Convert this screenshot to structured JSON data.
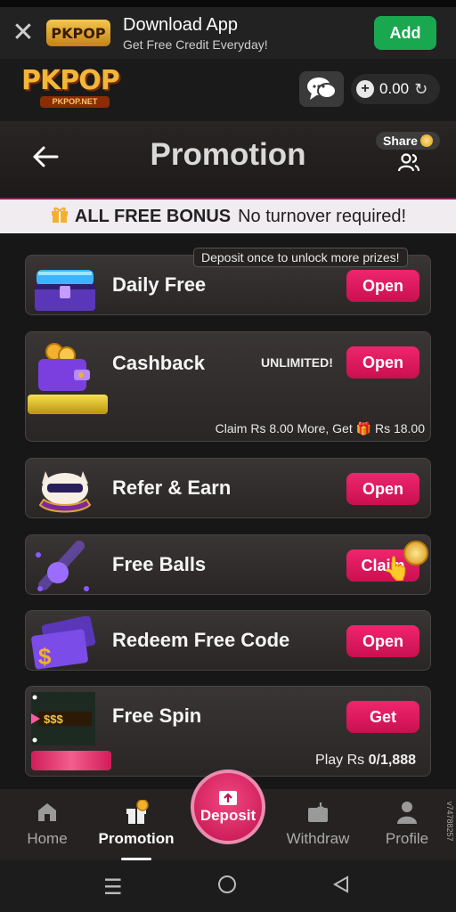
{
  "download_bar": {
    "close_icon": "close-icon",
    "logo_text": "PKPOP",
    "title": "Download App",
    "subtitle": "Get Free Credit Everyday!",
    "add_label": "Add"
  },
  "header": {
    "brand_main": "PKPOP",
    "brand_sub": "PKPOP.NET",
    "balance": "0.00"
  },
  "title_bar": {
    "title": "Promotion",
    "share_label": "Share"
  },
  "bonus_bar": {
    "title": "ALL FREE BONUS",
    "subtitle": "No turnover required!"
  },
  "cards": {
    "daily": {
      "label": "Daily Free",
      "button": "Open",
      "tip": "Deposit once to unlock more prizes!"
    },
    "cashback": {
      "label": "Cashback",
      "badge": "UNLIMITED!",
      "button": "Open",
      "claim_text": "Claim Rs 8.00 More, Get",
      "claim_amount": "Rs 18.00"
    },
    "refer": {
      "label": "Refer & Earn",
      "button": "Open"
    },
    "balls": {
      "label": "Free Balls",
      "button": "Claim"
    },
    "redeem": {
      "label": "Redeem Free Code",
      "button": "Open",
      "ticket_text": "$"
    },
    "spin": {
      "label": "Free Spin",
      "button": "Get",
      "ticket_text": "$$$",
      "play_prefix": "Play Rs",
      "play_value": "0/1,888"
    }
  },
  "bottom_nav": {
    "home": "Home",
    "promotion": "Promotion",
    "deposit": "Deposit",
    "withdraw": "Withdraw",
    "profile": "Profile",
    "active": "Promotion"
  },
  "side_text": "v74788257",
  "colors": {
    "accent": "#e61c62",
    "add_green": "#19a74f",
    "gold": "#f2b638"
  }
}
